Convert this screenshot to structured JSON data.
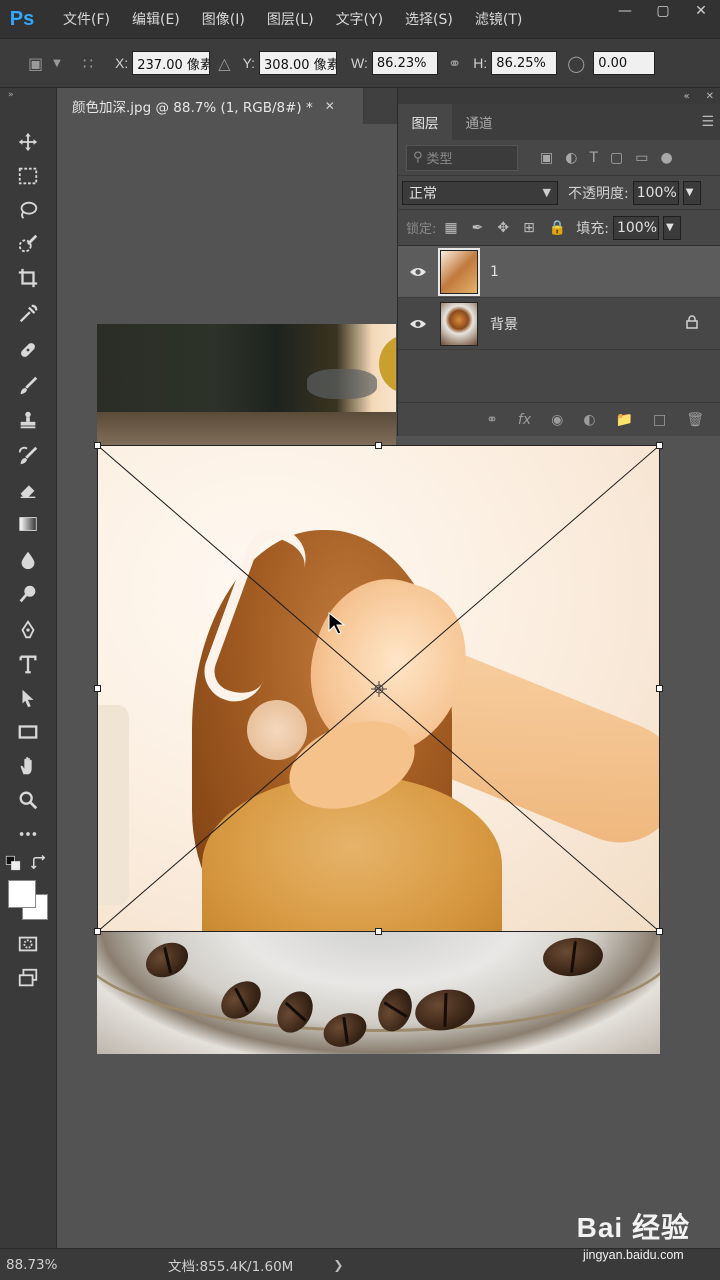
{
  "app": {
    "logo": "Ps"
  },
  "menu": [
    "文件(F)",
    "编辑(E)",
    "图像(I)",
    "图层(L)",
    "文字(Y)",
    "选择(S)",
    "滤镜(T)"
  ],
  "options": {
    "x_label": "X:",
    "x_value": "237.00 像素",
    "y_label": "Y:",
    "y_value": "308.00 像素",
    "w_label": "W:",
    "w_value": "86.23%",
    "h_label": "H:",
    "h_value": "86.25%",
    "angle_value": "0.00"
  },
  "document": {
    "tab_title": "颜色加深.jpg @ 88.7% (1, RGB/8#) *"
  },
  "layers_panel": {
    "tabs": [
      "图层",
      "通道"
    ],
    "filter_label": "类型",
    "blend_mode": "正常",
    "opacity_label": "不透明度:",
    "opacity_value": "100%",
    "lock_label": "锁定:",
    "fill_label": "填充:",
    "fill_value": "100%",
    "layers": [
      {
        "name": "1",
        "selected": true
      },
      {
        "name": "背景",
        "locked": true
      }
    ]
  },
  "status": {
    "zoom": "88.73%",
    "doc_info": "文档:855.4K/1.60M"
  },
  "watermark": {
    "title": "Bai 经验",
    "url": "jingyan.baidu.com"
  },
  "colors": {
    "brand": "#31a8ff",
    "panel_bg": "#474747",
    "canvas_bg": "#535353"
  }
}
